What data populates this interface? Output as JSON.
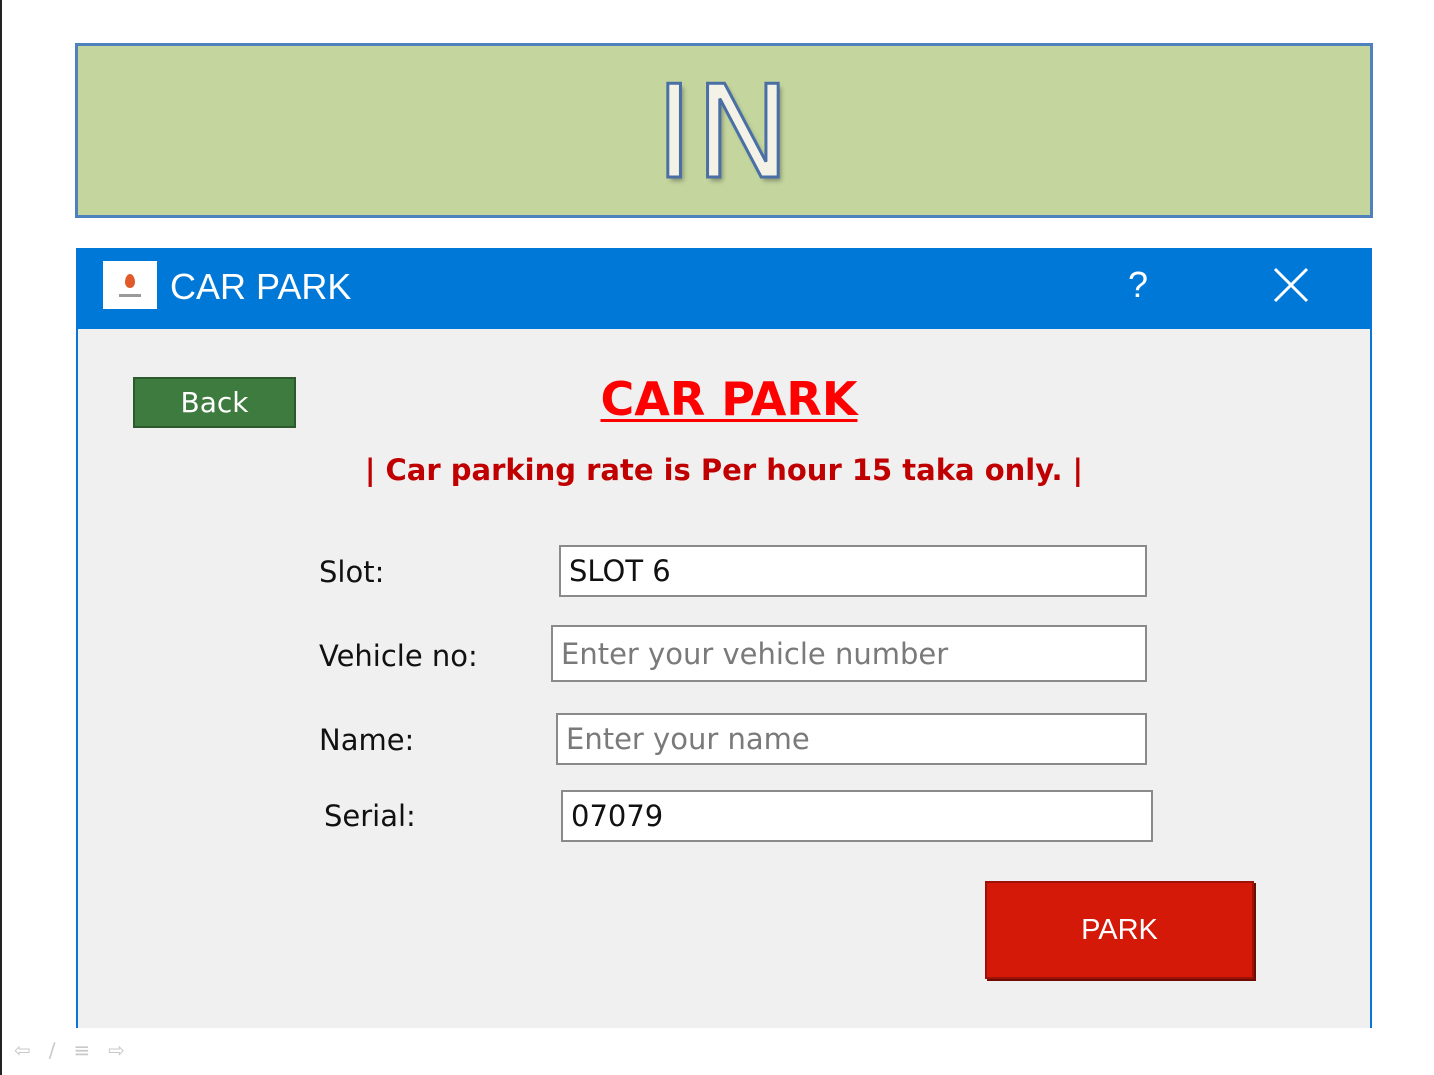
{
  "banner": {
    "title": "IN"
  },
  "window": {
    "title": "CAR PARK",
    "help_label": "?",
    "icons": {
      "app": "car-park-app-icon",
      "close": "close-icon"
    },
    "colors": {
      "titlebar": "#0078d7"
    }
  },
  "form": {
    "back_label": "Back",
    "heading": "CAR PARK",
    "rate_text": "| Car parking rate is Per hour 15 taka only. |",
    "slot": {
      "label": "Slot:",
      "value": "SLOT 6"
    },
    "vehicle": {
      "label": "Vehicle no:",
      "placeholder": "Enter your vehicle number"
    },
    "name": {
      "label": "Name:",
      "placeholder": "Enter your name"
    },
    "serial": {
      "label": "Serial:",
      "value": "07079"
    },
    "park_label": "PARK",
    "colors": {
      "back": "#3e7b3e",
      "park": "#d41908",
      "heading": "#ff0000",
      "rate": "#c00000"
    }
  },
  "slideshow_controls": {
    "icons": [
      "arrow-left-icon",
      "pen-icon",
      "menu-icon",
      "arrow-right-icon"
    ]
  }
}
